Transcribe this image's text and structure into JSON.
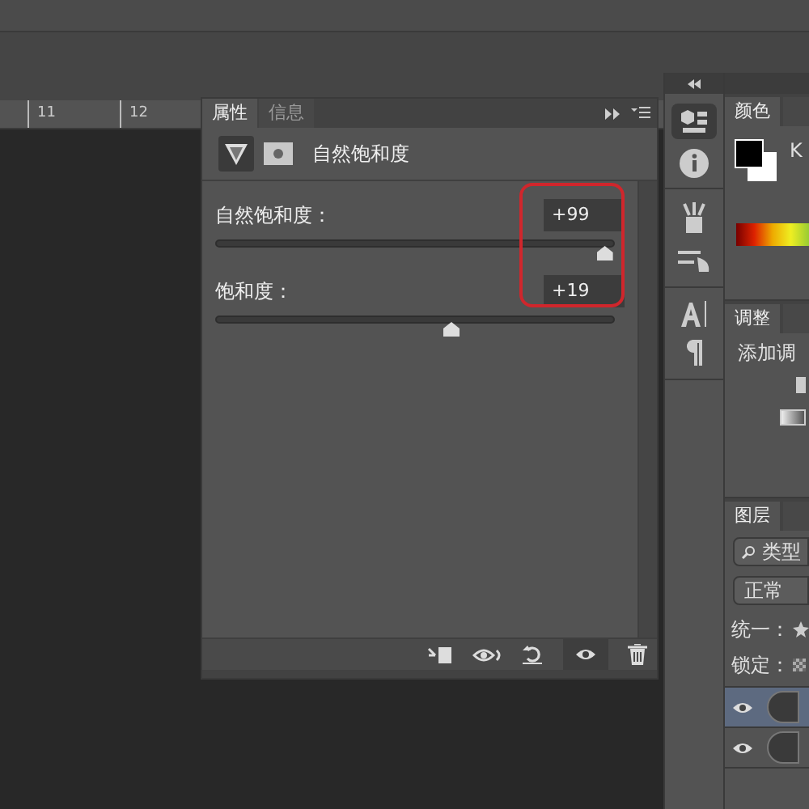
{
  "ruler": {
    "ticks": [
      "11",
      "12"
    ]
  },
  "properties_panel": {
    "tabs": [
      {
        "label": "属性",
        "selected": true
      },
      {
        "label": "信息",
        "selected": false
      }
    ],
    "title": "自然饱和度",
    "sliders": [
      {
        "label": "自然饱和度：",
        "value": "+99",
        "level": 0.995
      },
      {
        "label": "饱和度：",
        "value": "+19",
        "level": 0.595
      }
    ]
  },
  "color_panel": {
    "tabs": [
      {
        "label": "颜色",
        "selected": true
      }
    ],
    "channel_label": "K"
  },
  "adjustments_panel": {
    "tabs": [
      {
        "label": "调整",
        "selected": true
      }
    ],
    "hint": "添加调"
  },
  "layers_panel": {
    "tabs": [
      {
        "label": "图层",
        "selected": true
      }
    ],
    "search": {
      "value": "类型"
    },
    "blend_mode": "正常",
    "unify_label": "统一：",
    "lock_label": "锁定：",
    "layers": [
      {
        "selected": true,
        "visible": true
      },
      {
        "selected": false,
        "visible": true
      }
    ]
  }
}
